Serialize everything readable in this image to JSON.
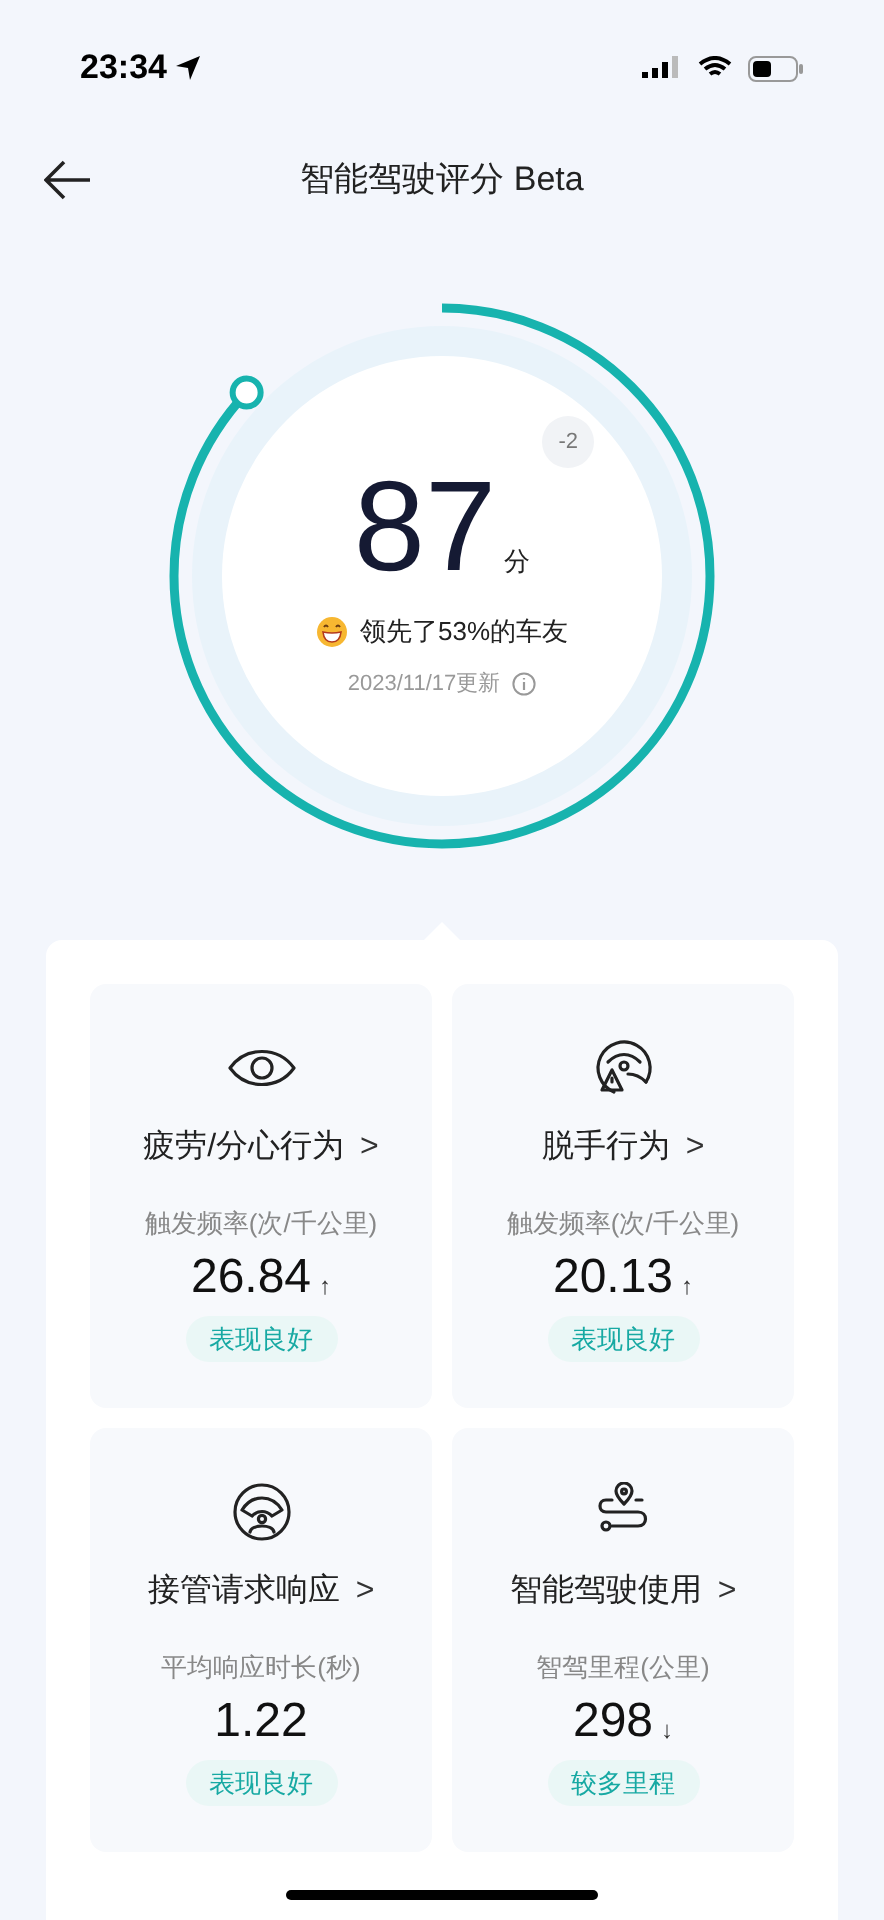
{
  "status_bar": {
    "time": "23:34"
  },
  "header": {
    "title": "智能驾驶评分 Beta"
  },
  "score": {
    "value": "87",
    "unit": "分",
    "delta": "-2",
    "rank": "领先了53%的车友",
    "updated": "2023/11/17更新"
  },
  "cards": [
    {
      "kind": "eye",
      "title": "疲劳/分心行为",
      "chevron": ">",
      "metric": "触发频率(次/千公里)",
      "value": "26.84",
      "trend": "↑",
      "badge": "表现良好"
    },
    {
      "kind": "hands-off",
      "title": "脱手行为",
      "chevron": ">",
      "metric": "触发频率(次/千公里)",
      "value": "20.13",
      "trend": "↑",
      "badge": "表现良好"
    },
    {
      "kind": "wheel",
      "title": "接管请求响应",
      "chevron": ">",
      "metric": "平均响应时长(秒)",
      "value": "1.22",
      "badge": "表现良好"
    },
    {
      "kind": "route",
      "title": "智能驾驶使用",
      "chevron": ">",
      "metric": "智驾里程(公里)",
      "value": "298",
      "trend": "↓",
      "badge": "较多里程"
    }
  ]
}
